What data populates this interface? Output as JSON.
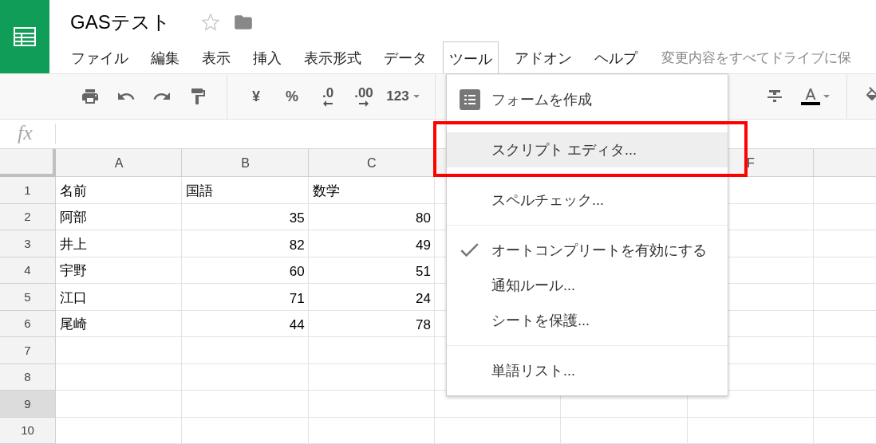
{
  "document": {
    "title": "GASテスト",
    "starred": false
  },
  "menubar": [
    {
      "label": "ファイル",
      "selected": false
    },
    {
      "label": "編集",
      "selected": false
    },
    {
      "label": "表示",
      "selected": false
    },
    {
      "label": "挿入",
      "selected": false
    },
    {
      "label": "表示形式",
      "selected": false
    },
    {
      "label": "データ",
      "selected": false
    },
    {
      "label": "ツール",
      "selected": true
    },
    {
      "label": "アドオン",
      "selected": false
    },
    {
      "label": "ヘルプ",
      "selected": false
    }
  ],
  "save_status": "変更内容をすべてドライブに保",
  "toolbar": {
    "left": [
      {
        "kind": "print"
      },
      {
        "kind": "undo"
      },
      {
        "kind": "redo"
      },
      {
        "kind": "paint-format"
      },
      {
        "kind": "separator"
      },
      {
        "kind": "text",
        "label": "¥"
      },
      {
        "kind": "text",
        "label": "%"
      },
      {
        "kind": "decimal-less",
        "label": ".0"
      },
      {
        "kind": "decimal-more",
        "label": ".00"
      },
      {
        "kind": "dropdown",
        "label": "123"
      },
      {
        "kind": "separator"
      }
    ],
    "right": [
      {
        "kind": "strike"
      },
      {
        "kind": "text-color"
      },
      {
        "kind": "separator"
      },
      {
        "kind": "fill-color"
      }
    ]
  },
  "formula_bar": {
    "label": "fx"
  },
  "sheet": {
    "columns": [
      {
        "label": "A"
      },
      {
        "label": "B"
      },
      {
        "label": "C"
      },
      {},
      {},
      {
        "label": "F"
      },
      {}
    ],
    "rows": [
      {
        "header": "1",
        "selected": false,
        "cells": [
          {
            "kind": "text",
            "text": "名前"
          },
          {
            "kind": "text",
            "text": "国語"
          },
          {
            "kind": "text",
            "text": "数学"
          }
        ]
      },
      {
        "header": "2",
        "selected": false,
        "cells": [
          {
            "kind": "text",
            "text": "阿部"
          },
          {
            "kind": "number",
            "text": "35"
          },
          {
            "kind": "number",
            "text": "80"
          }
        ]
      },
      {
        "header": "3",
        "selected": false,
        "cells": [
          {
            "kind": "text",
            "text": "井上"
          },
          {
            "kind": "number",
            "text": "82"
          },
          {
            "kind": "number",
            "text": "49"
          }
        ]
      },
      {
        "header": "4",
        "selected": false,
        "cells": [
          {
            "kind": "text",
            "text": "宇野"
          },
          {
            "kind": "number",
            "text": "60"
          },
          {
            "kind": "number",
            "text": "51"
          }
        ]
      },
      {
        "header": "5",
        "selected": false,
        "cells": [
          {
            "kind": "text",
            "text": "江口"
          },
          {
            "kind": "number",
            "text": "71"
          },
          {
            "kind": "number",
            "text": "24"
          }
        ]
      },
      {
        "header": "6",
        "selected": false,
        "cells": [
          {
            "kind": "text",
            "text": "尾崎"
          },
          {
            "kind": "number",
            "text": "44"
          },
          {
            "kind": "number",
            "text": "78"
          }
        ]
      },
      {
        "header": "7",
        "selected": false
      },
      {
        "header": "8",
        "selected": false
      },
      {
        "header": "9",
        "selected": true
      },
      {
        "header": "10",
        "selected": false
      }
    ]
  },
  "tools_menu": {
    "groups": [
      {
        "items": [
          {
            "kind": "form",
            "label": "フォームを作成",
            "selected": false,
            "checked": false
          }
        ]
      },
      {
        "items": [
          {
            "kind": "plain",
            "label": "スクリプト エディタ...",
            "selected": true,
            "checked": false
          }
        ]
      },
      {
        "items": [
          {
            "kind": "plain",
            "label": "スペルチェック...",
            "selected": false,
            "checked": false
          }
        ]
      },
      {
        "items": [
          {
            "kind": "plain",
            "label": "オートコンプリートを有効にする",
            "selected": false,
            "checked": true
          },
          {
            "kind": "plain",
            "label": "通知ルール...",
            "selected": false,
            "checked": false
          },
          {
            "kind": "plain",
            "label": "シートを保護...",
            "selected": false,
            "checked": false
          }
        ]
      },
      {
        "items": [
          {
            "kind": "plain",
            "label": "単語リスト...",
            "selected": false,
            "checked": false
          }
        ]
      }
    ]
  },
  "annotation_frame": true
}
